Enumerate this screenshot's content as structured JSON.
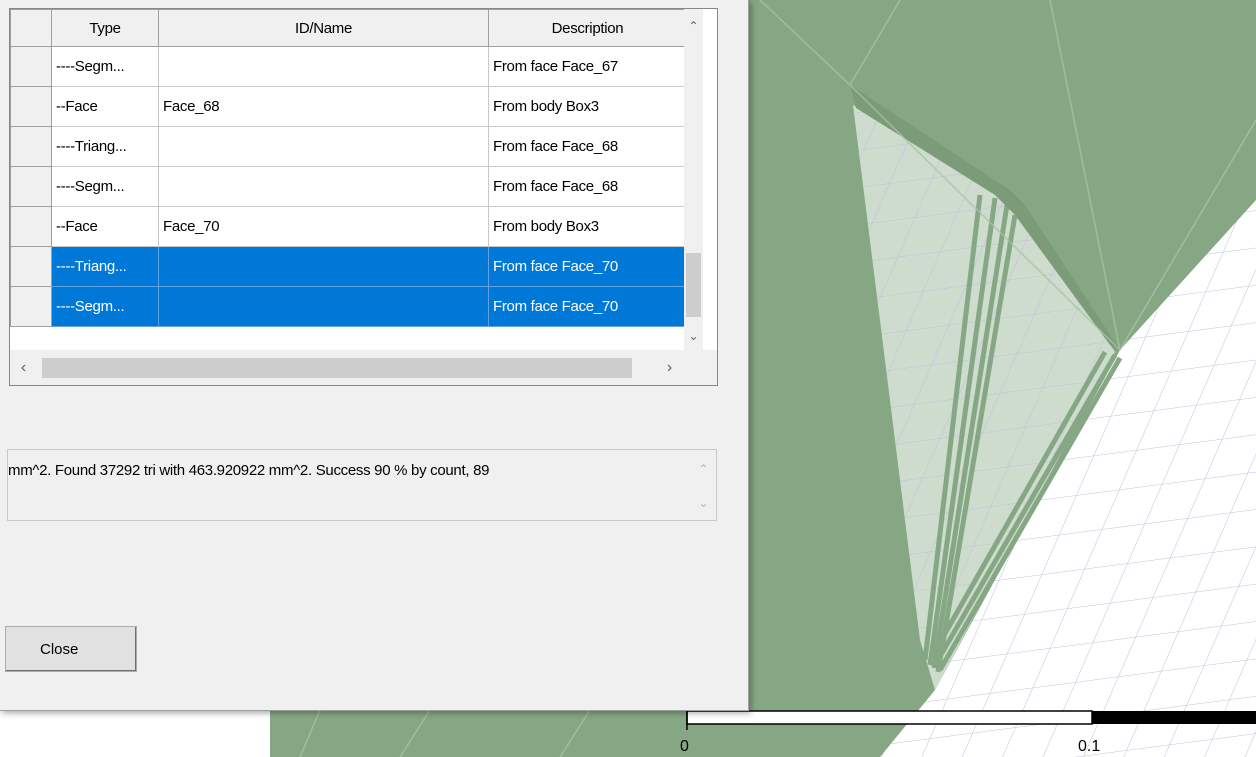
{
  "table": {
    "columns": [
      "Type",
      "ID/Name",
      "Description"
    ],
    "rows": [
      {
        "type": "----Segm...",
        "id": "",
        "description": "From face Face_67",
        "selected": false
      },
      {
        "type": "--Face",
        "id": "Face_68",
        "description": "From body Box3",
        "selected": false
      },
      {
        "type": "----Triang...",
        "id": "",
        "description": "From face Face_68",
        "selected": false
      },
      {
        "type": "----Segm...",
        "id": "",
        "description": "From face Face_68",
        "selected": false
      },
      {
        "type": "--Face",
        "id": "Face_70",
        "description": "From body Box3",
        "selected": false
      },
      {
        "type": "----Triang...",
        "id": "",
        "description": "From face Face_70",
        "selected": true
      },
      {
        "type": "----Segm...",
        "id": "",
        "description": "From face Face_70",
        "selected": true
      }
    ]
  },
  "message": "mm^2. Found 37292 tri with 463.920922 mm^2. Success 90 % by count, 89",
  "close_label": "Close",
  "scale_bar": {
    "label_start": "0",
    "label_mid": "0.1"
  },
  "colors": {
    "selection": "#0078d7",
    "model_fill": "#86a784",
    "mesh_line": "#b8b9d6",
    "dialog_bg": "#f0f0f0"
  }
}
